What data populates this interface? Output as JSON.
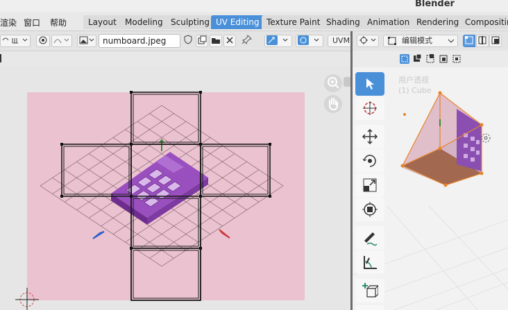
{
  "app": {
    "title": "Blender"
  },
  "menu": {
    "render": "渲染",
    "window": "窗口",
    "help": "帮助"
  },
  "workspaces": [
    "Layout",
    "Modeling",
    "Sculpting",
    "UV Editing",
    "Texture Paint",
    "Shading",
    "Animation",
    "Rendering",
    "Compositing"
  ],
  "active_workspace": "UV Editing",
  "uv_header": {
    "image_name": "numboard.jpeg",
    "uvmap_label": "UVM"
  },
  "viewport_header": {
    "mode": "编辑模式"
  },
  "viewport": {
    "view_name": "用户透视",
    "object_name": "(1) Cube"
  },
  "colors": {
    "accent": "#4a90d9",
    "uv_background": "#ebc3d0",
    "selection": "#e8832a",
    "face_fill": "#c98a9a"
  },
  "toolbar_tools": [
    "select-box-icon",
    "cursor-icon",
    "move-icon",
    "rotate-icon",
    "scale-icon",
    "transform-icon",
    "annotate-icon",
    "measure-icon",
    "add-cube-icon"
  ]
}
